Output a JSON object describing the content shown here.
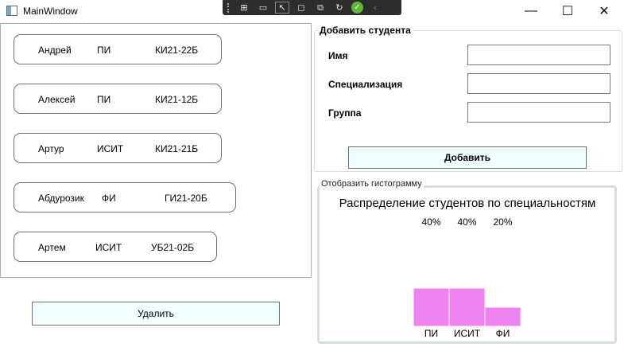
{
  "window": {
    "title": "MainWindow",
    "minimize_glyph": "—",
    "maximize_glyph": "☐",
    "close_glyph": "✕"
  },
  "debug_toolbar": {
    "icons": [
      "select-element-icon",
      "live-tree-icon",
      "video-icon",
      "select-pointer-icon",
      "display-layout-icon",
      "track-focus-icon",
      "hot-reload-icon",
      "check-icon",
      "collapse-icon"
    ]
  },
  "students": [
    {
      "name": "Андрей",
      "specialization": "ПИ",
      "group": "КИ21-22Б"
    },
    {
      "name": "Алексей",
      "specialization": "ПИ",
      "group": "КИ21-12Б"
    },
    {
      "name": "Артур",
      "specialization": "ИСИТ",
      "group": "КИ21-21Б"
    },
    {
      "name": "Абдурозик",
      "specialization": "ФИ",
      "group": "ГИ21-20Б"
    },
    {
      "name": "Артем",
      "specialization": "ИСИТ",
      "group": "УБ21-02Б"
    }
  ],
  "delete_button": "Удалить",
  "add_form": {
    "title": "Добавить студента",
    "name_label": "Имя",
    "spec_label": "Специализация",
    "group_label": "Группа",
    "name_value": "",
    "spec_value": "",
    "group_value": "",
    "add_button": "Добавить"
  },
  "histogram": {
    "groupbox_title": "Отобразить гистограмму",
    "bar_color": "#ee82ee"
  },
  "chart_data": {
    "type": "bar",
    "title": "Распределение студентов по специальностям",
    "categories": [
      "ПИ",
      "ИСИТ",
      "ФИ"
    ],
    "values": [
      40,
      40,
      20
    ],
    "data_labels": [
      "40%",
      "40%",
      "20%"
    ],
    "ylim": [
      0,
      100
    ],
    "xlabel": "",
    "ylabel": "",
    "grid": false
  }
}
